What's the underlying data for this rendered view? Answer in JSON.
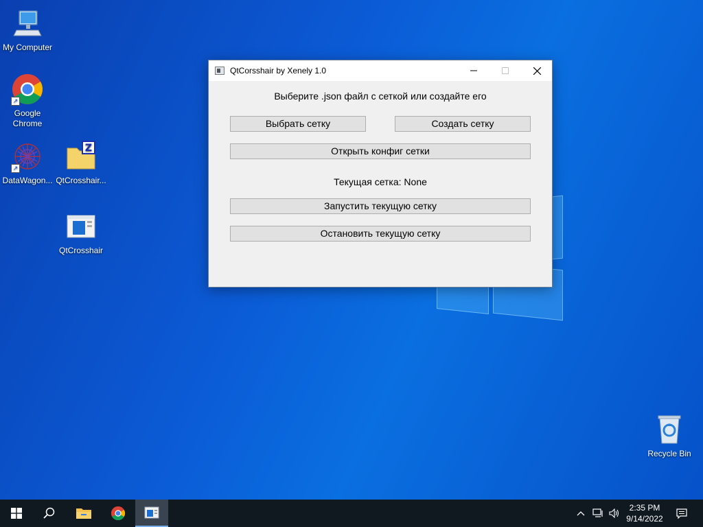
{
  "desktop": {
    "icons": [
      {
        "label": "My Computer"
      },
      {
        "label": "Google Chrome"
      },
      {
        "label": "DataWagon..."
      },
      {
        "label": "QtCrosshair..."
      },
      {
        "label": "QtCrosshair"
      },
      {
        "label": "Recycle Bin"
      }
    ]
  },
  "window": {
    "title": "QtCorsshair by Xenely 1.0",
    "prompt": "Выберите .json файл с сеткой или создайте его",
    "choose_button": "Выбрать сетку",
    "create_button": "Создать сетку",
    "open_config_button": "Открыть конфиг сетки",
    "current_grid_label": "Текущая сетка: None",
    "start_button": "Запустить текущую сетку",
    "stop_button": "Остановить текущую сетку"
  },
  "taskbar": {
    "time": "2:35 PM",
    "date": "9/14/2022"
  },
  "colors": {
    "accent": "#0b5bd6",
    "taskbar": "#101820",
    "button_face": "#e1e1e1"
  }
}
